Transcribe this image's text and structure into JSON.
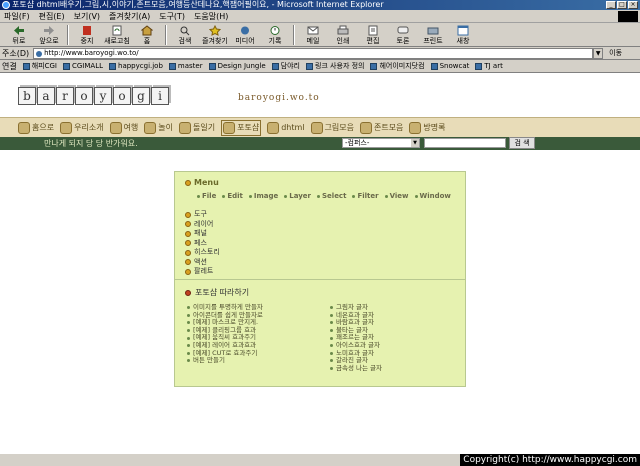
{
  "window": {
    "title": "포토샵 dhtml배우기,그림,시,이야기,존트모음,여행등산데나요,핵잼어필이요, - Microsoft Internet Explorer",
    "controls": [
      "_",
      "□",
      "×"
    ]
  },
  "menubar": [
    "파일(F)",
    "편집(E)",
    "보기(V)",
    "즐겨찾기(A)",
    "도구(T)",
    "도움말(H)"
  ],
  "toolbar": [
    {
      "label": "뒤로",
      "icon": "back-arrow-icon"
    },
    {
      "label": "앞으로",
      "icon": "forward-arrow-icon"
    },
    {
      "label": "중지",
      "icon": "stop-icon"
    },
    {
      "label": "새로고침",
      "icon": "refresh-icon"
    },
    {
      "label": "홈",
      "icon": "home-icon"
    },
    {
      "label": "검색",
      "icon": "search-icon"
    },
    {
      "label": "즐겨찾기",
      "icon": "favorites-icon"
    },
    {
      "label": "미디어",
      "icon": "media-icon"
    },
    {
      "label": "기록",
      "icon": "history-icon"
    },
    {
      "label": "메일",
      "icon": "mail-icon"
    },
    {
      "label": "인쇄",
      "icon": "print-icon"
    },
    {
      "label": "편집",
      "icon": "edit-icon"
    },
    {
      "label": "토론",
      "icon": "discuss-icon"
    },
    {
      "label": "프린트",
      "icon": "printer-icon"
    },
    {
      "label": "새창",
      "icon": "new-window-icon"
    }
  ],
  "address": {
    "label": "주소(D)",
    "url": "http://www.baroyogi.wo.to/",
    "go": "이동"
  },
  "links": {
    "label": "연결",
    "items": [
      "해피CGI",
      "CGIMALL",
      "happycgi.job",
      "master",
      "Design Jungle",
      "담야리",
      "링크 사용자 정의",
      "헤어이미지닷컴",
      "Snowcat",
      "TJ art"
    ]
  },
  "site": {
    "logo_letters": [
      "b",
      "a",
      "r",
      "o",
      "y",
      "o",
      "g",
      "i"
    ],
    "url_text": "baroyogi.wo.to",
    "nav": [
      "홈으로",
      "우리소개",
      "여행",
      "놀이",
      "돌일기",
      "포토샵",
      "dhtml",
      "그림모음",
      "존트모음",
      "방명록"
    ],
    "active_nav": "포토샵",
    "tagline": "만나게 되지 당 당 반가워요.",
    "search_select": "-컴퍼스-",
    "search_button": "검 색"
  },
  "panel": {
    "menu_title": "Menu",
    "tools": [
      "File",
      "Edit",
      "Image",
      "Layer",
      "Select",
      "Filter",
      "View",
      "Window"
    ],
    "categories": [
      "도구",
      "레이어",
      "패널",
      "페스",
      "히스토리",
      "액션",
      "팔레트"
    ],
    "section_title": "포토샵 따라하기",
    "left_items": [
      "이미지를 투명하게 만들자",
      "아이콘더를 쉽게 만들자로",
      "[예제] 마스크로 만지게.",
      "[예제] 클리핑그룹 효과",
      "[예제] 움직씨 효과주기",
      "[예제] 레이어 효과효과",
      "[예제] CUT로 효과주기",
      "버튼 만들기"
    ],
    "right_items": [
      "그림자 글자",
      "네온효과 글자",
      "바람효과 글자",
      "불타는 글자",
      "꽤조르는 글자",
      "아이스효과 글자",
      "노미효과 글자",
      "갈라진 글자",
      "금속성 나는 글자"
    ]
  },
  "copyright": "Copyright(c) http://www.happycgi.com"
}
